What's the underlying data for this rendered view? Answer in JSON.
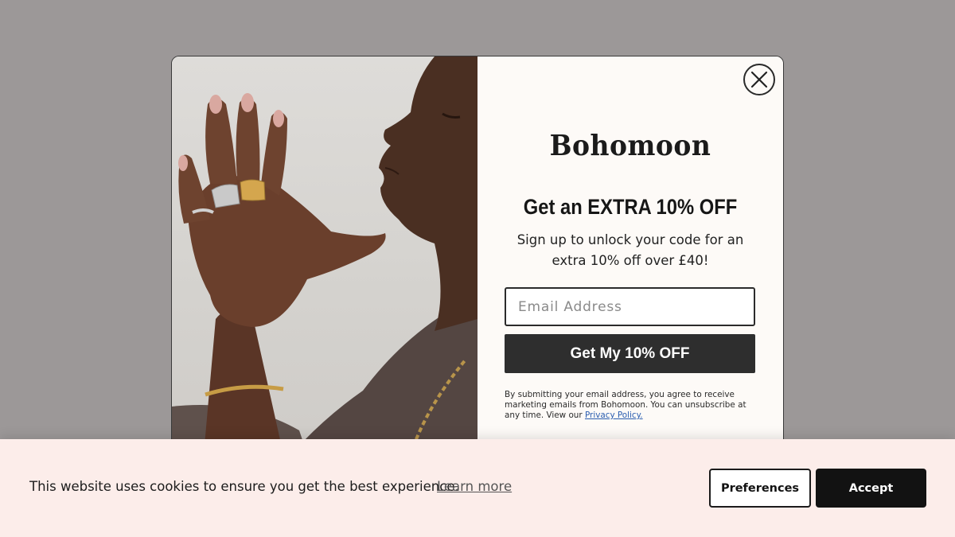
{
  "overlay": {
    "background": "#9c9898"
  },
  "popup": {
    "brand": "Bohomoon",
    "headline": "Get an EXTRA 10% OFF",
    "subtext": "Sign up to unlock your code for an extra 10% off over £40!",
    "email": {
      "placeholder": "Email Address",
      "value": ""
    },
    "cta_label": "Get My 10% OFF",
    "legal_text": "By submitting your email address, you agree to receive marketing emails from Bohomoon. You can unsubscribe at any time. View our ",
    "privacy_link": "Privacy Policy.",
    "close_icon": "close-icon",
    "colors": {
      "cta": "#2e2e2e",
      "panel": "#fdfaf7",
      "link": "#2a5db0"
    }
  },
  "cookie_bar": {
    "message": "This website uses cookies to ensure you get the best experience.",
    "learn_more": "Learn more",
    "preferences_label": "Preferences",
    "accept_label": "Accept",
    "colors": {
      "background": "#fcedea",
      "accept": "#121212"
    }
  }
}
